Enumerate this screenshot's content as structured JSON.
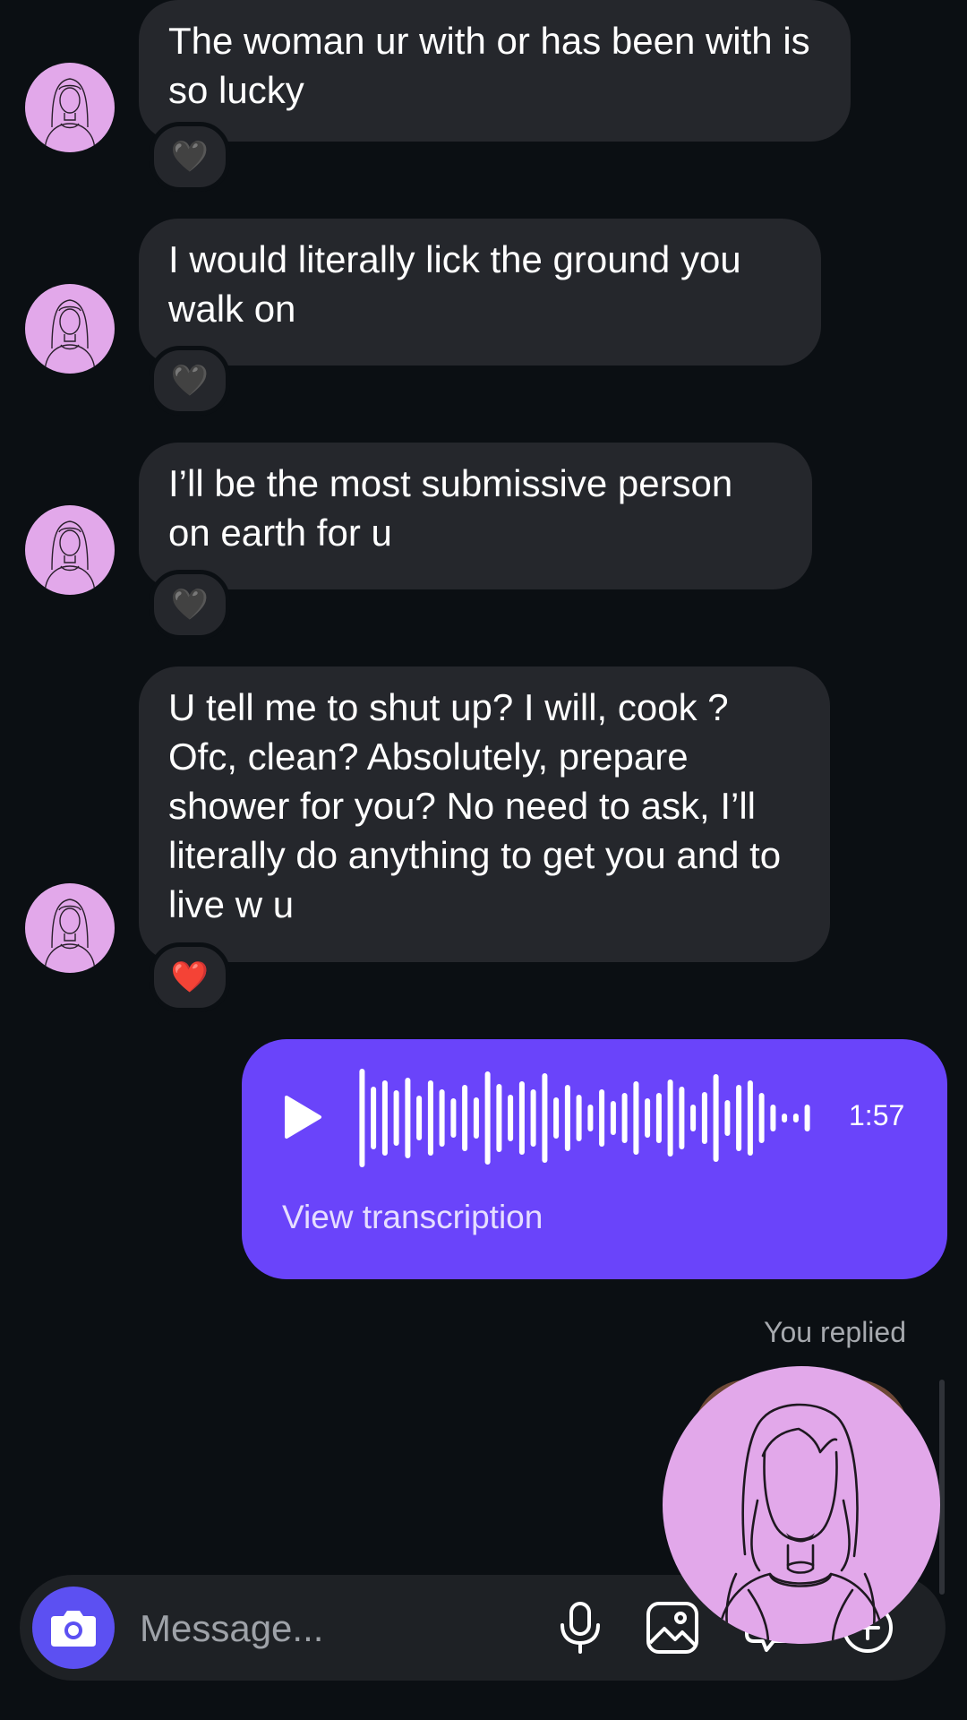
{
  "messages": [
    {
      "text": "The woman ur with or has been with is so lucky",
      "reaction": "🖤"
    },
    {
      "text": "I would literally lick the ground you walk on",
      "reaction": "🖤"
    },
    {
      "text": "I’ll be the most submissive person on earth for u",
      "reaction": "🖤"
    },
    {
      "text": "U tell me to shut up? I will, cook ? Ofc, clean? Absolutely, prepare shower for you? No need to ask, I’ll literally do anything to get you and to live w u",
      "reaction": "❤️"
    }
  ],
  "voice_message": {
    "duration": "1:57",
    "transcription_link": "View transcription",
    "bubble_color": "#6a44fa"
  },
  "reply_status": "You replied",
  "composer": {
    "placeholder": "Message...",
    "icons": [
      "camera-icon",
      "microphone-icon",
      "gallery-icon",
      "sticker-icon",
      "plus-icon"
    ]
  },
  "colors": {
    "background": "#0b0f13",
    "incoming_bubble": "#25272c",
    "avatar": "#e2a8ea",
    "camera_button": "#5c50f2"
  }
}
